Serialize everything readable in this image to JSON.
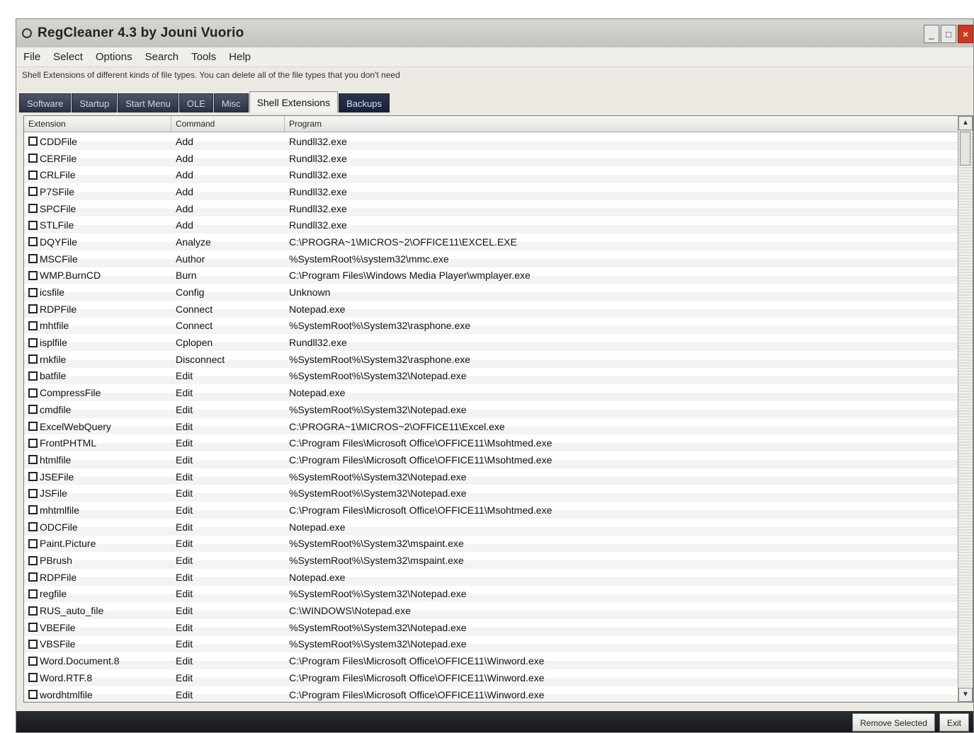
{
  "window": {
    "title": "RegCleaner 4.3 by Jouni Vuorio",
    "controls": {
      "minimize": "_",
      "maximize": "□",
      "close": "×"
    }
  },
  "menu": [
    "File",
    "Select",
    "Options",
    "Search",
    "Tools",
    "Help"
  ],
  "description": "Shell Extensions of different kinds of file types. You can delete all of the file types that you don't need",
  "tabs": [
    "Software",
    "Startup",
    "Start Menu",
    "OLE",
    "Misc",
    "Shell Extensions",
    "Backups"
  ],
  "columns": [
    "Extension",
    "Command",
    "Program"
  ],
  "rows": [
    {
      "extension": "CDDFile",
      "command": "Add",
      "program": "Rundll32.exe"
    },
    {
      "extension": "CERFile",
      "command": "Add",
      "program": "Rundll32.exe"
    },
    {
      "extension": "CRLFile",
      "command": "Add",
      "program": "Rundll32.exe"
    },
    {
      "extension": "P7SFile",
      "command": "Add",
      "program": "Rundll32.exe"
    },
    {
      "extension": "SPCFile",
      "command": "Add",
      "program": "Rundll32.exe"
    },
    {
      "extension": "STLFile",
      "command": "Add",
      "program": "Rundll32.exe"
    },
    {
      "extension": "DQYFile",
      "command": "Analyze",
      "program": "C:\\PROGRA~1\\MICROS~2\\OFFICE11\\EXCEL.EXE"
    },
    {
      "extension": "MSCFile",
      "command": "Author",
      "program": "%SystemRoot%\\system32\\mmc.exe"
    },
    {
      "extension": "WMP.BurnCD",
      "command": "Burn",
      "program": "C:\\Program Files\\Windows Media Player\\wmplayer.exe"
    },
    {
      "extension": "icsfile",
      "command": "Config",
      "program": "Unknown"
    },
    {
      "extension": "RDPFile",
      "command": "Connect",
      "program": "Notepad.exe"
    },
    {
      "extension": "mhtfile",
      "command": "Connect",
      "program": "%SystemRoot%\\System32\\rasphone.exe"
    },
    {
      "extension": "isplfile",
      "command": "Cplopen",
      "program": "Rundll32.exe"
    },
    {
      "extension": "rnkfile",
      "command": "Disconnect",
      "program": "%SystemRoot%\\System32\\rasphone.exe"
    },
    {
      "extension": "batfile",
      "command": "Edit",
      "program": "%SystemRoot%\\System32\\Notepad.exe"
    },
    {
      "extension": "CompressFile",
      "command": "Edit",
      "program": "Notepad.exe"
    },
    {
      "extension": "cmdfile",
      "command": "Edit",
      "program": "%SystemRoot%\\System32\\Notepad.exe"
    },
    {
      "extension": "ExcelWebQuery",
      "command": "Edit",
      "program": "C:\\PROGRA~1\\MICROS~2\\OFFICE11\\Excel.exe"
    },
    {
      "extension": "FrontPHTML",
      "command": "Edit",
      "program": "C:\\Program Files\\Microsoft Office\\OFFICE11\\Msohtmed.exe"
    },
    {
      "extension": "htmlfile",
      "command": "Edit",
      "program": "C:\\Program Files\\Microsoft Office\\OFFICE11\\Msohtmed.exe"
    },
    {
      "extension": "JSEFile",
      "command": "Edit",
      "program": "%SystemRoot%\\System32\\Notepad.exe"
    },
    {
      "extension": "JSFile",
      "command": "Edit",
      "program": "%SystemRoot%\\System32\\Notepad.exe"
    },
    {
      "extension": "mhtmlfile",
      "command": "Edit",
      "program": "C:\\Program Files\\Microsoft Office\\OFFICE11\\Msohtmed.exe"
    },
    {
      "extension": "ODCFile",
      "command": "Edit",
      "program": "Notepad.exe"
    },
    {
      "extension": "Paint.Picture",
      "command": "Edit",
      "program": "%SystemRoot%\\System32\\mspaint.exe"
    },
    {
      "extension": "PBrush",
      "command": "Edit",
      "program": "%SystemRoot%\\System32\\mspaint.exe"
    },
    {
      "extension": "RDPFile",
      "command": "Edit",
      "program": "Notepad.exe"
    },
    {
      "extension": "regfile",
      "command": "Edit",
      "program": "%SystemRoot%\\System32\\Notepad.exe"
    },
    {
      "extension": "RUS_auto_file",
      "command": "Edit",
      "program": "C:\\WINDOWS\\Notepad.exe"
    },
    {
      "extension": "VBEFile",
      "command": "Edit",
      "program": "%SystemRoot%\\System32\\Notepad.exe"
    },
    {
      "extension": "VBSFile",
      "command": "Edit",
      "program": "%SystemRoot%\\System32\\Notepad.exe"
    },
    {
      "extension": "Word.Document.8",
      "command": "Edit",
      "program": "C:\\Program Files\\Microsoft Office\\OFFICE11\\Winword.exe"
    },
    {
      "extension": "Word.RTF.8",
      "command": "Edit",
      "program": "C:\\Program Files\\Microsoft Office\\OFFICE11\\Winword.exe"
    },
    {
      "extension": "wordhtmlfile",
      "command": "Edit",
      "program": "C:\\Program Files\\Microsoft Office\\OFFICE11\\Winword.exe"
    }
  ],
  "buttons": {
    "remove_selected": "Remove Selected",
    "exit": "Exit"
  },
  "colors": {
    "titlebar": "#cfcfcb",
    "tab_dark": "#2a3140",
    "status_bar": "#1e2024",
    "close_button": "#c8391f"
  }
}
